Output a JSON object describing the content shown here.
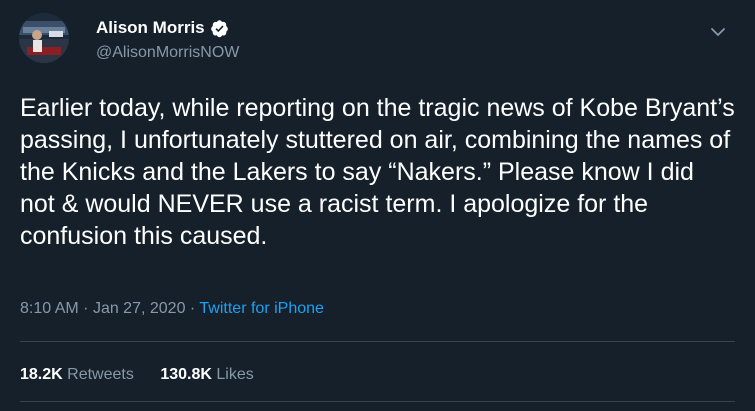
{
  "author": {
    "display_name": "Alison Morris",
    "handle": "@AlisonMorrisNOW",
    "verified": true
  },
  "tweet": {
    "text": "Earlier today, while reporting on the tragic news of Kobe Bryant’s passing, I unfortunately stuttered on air, combining the names of the Knicks and the Lakers to say “Nakers.” Please know I did not & would NEVER use a racist term. I apologize for the confusion this caused.",
    "time": "8:10 AM",
    "separator": "·",
    "date": "Jan 27, 2020",
    "source": "Twitter for iPhone"
  },
  "stats": {
    "retweets_count": "18.2K",
    "retweets_label": "Retweets",
    "likes_count": "130.8K",
    "likes_label": "Likes"
  },
  "colors": {
    "background": "#15202b",
    "text": "#ffffff",
    "muted": "#8899a6",
    "accent": "#1da1f2",
    "divider": "#38444d"
  },
  "icons": {
    "verified": "verified-badge-icon",
    "more": "chevron-down-icon"
  }
}
